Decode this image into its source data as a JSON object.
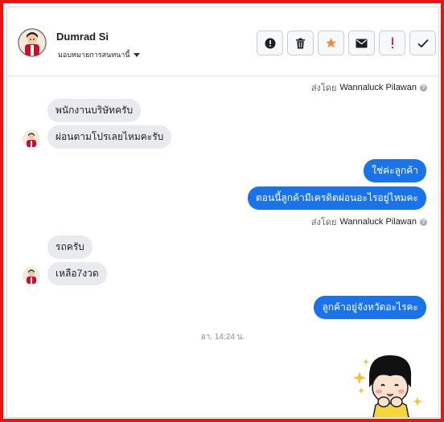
{
  "contact": {
    "name": "Dumrad Si",
    "assign_label": "มอบหมายการสนทนานี้"
  },
  "toolbar": {
    "buttons": [
      {
        "name": "alert-circle-button",
        "icon": "alert-circle-icon",
        "color": "#1c1e21"
      },
      {
        "name": "delete-button",
        "icon": "trash-icon",
        "color": "#1c1e21"
      },
      {
        "name": "star-button",
        "icon": "star-icon",
        "color": "#f0883e"
      },
      {
        "name": "mark-unread-button",
        "icon": "envelope-icon",
        "color": "#1c1e21"
      },
      {
        "name": "spam-button",
        "icon": "exclamation-icon",
        "color": "#e0245e"
      },
      {
        "name": "done-button",
        "icon": "check-icon",
        "color": "#1c1e21"
      }
    ]
  },
  "messages": {
    "sent_by_prefix": "ส่งโดย",
    "sent_by_name": "Wannaluck Pilawan",
    "in_1": "พนักงานบริษัทครับ",
    "in_2": "ผ่อนตามโปรเลยไหมคะรับ",
    "out_1": "ใช่ค่ะลูกค้า",
    "out_2": "ตอนนี้ลูกค้ามีเครดิตผ่อนอะไรอยู่ไหมคะ",
    "in_3": "รถครับ",
    "in_4": "เหลือ7งวด",
    "out_3": "ลูกค้าอยู่จังหวัดอะไรคะ",
    "timestamp": "อา. 14:24 น."
  },
  "colors": {
    "frame_border": "#ee1111",
    "outgoing_bubble": "#1a73e8",
    "incoming_bubble": "#e9eaed",
    "star": "#f0883e",
    "spam": "#e0245e"
  }
}
